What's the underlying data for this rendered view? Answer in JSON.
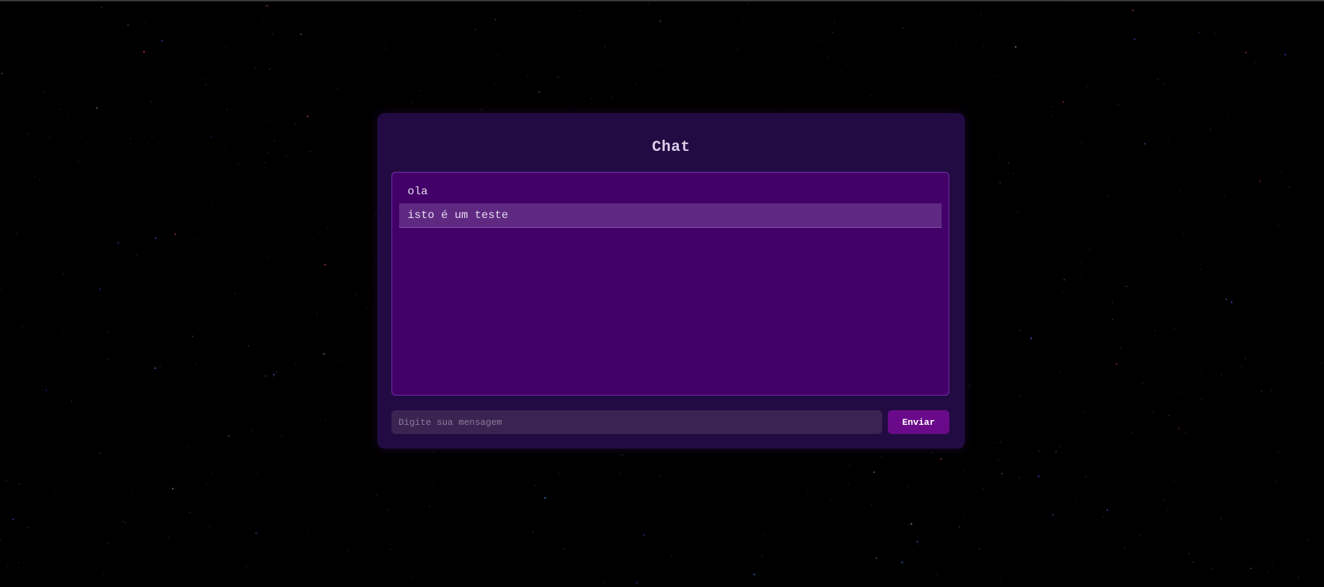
{
  "chat": {
    "title": "Chat",
    "messages": [
      {
        "text": "ola",
        "highlighted": false
      },
      {
        "text": "isto é um teste",
        "highlighted": true
      }
    ]
  },
  "input": {
    "placeholder": "Digite sua mensagem",
    "value": ""
  },
  "send_button": {
    "label": "Enviar"
  },
  "colors": {
    "background": "#000000",
    "panel": "#220b43",
    "messages_box": "#420068",
    "highlight_row": "#5f2982",
    "input": "#3b2452",
    "button": "#6a0a8a"
  }
}
